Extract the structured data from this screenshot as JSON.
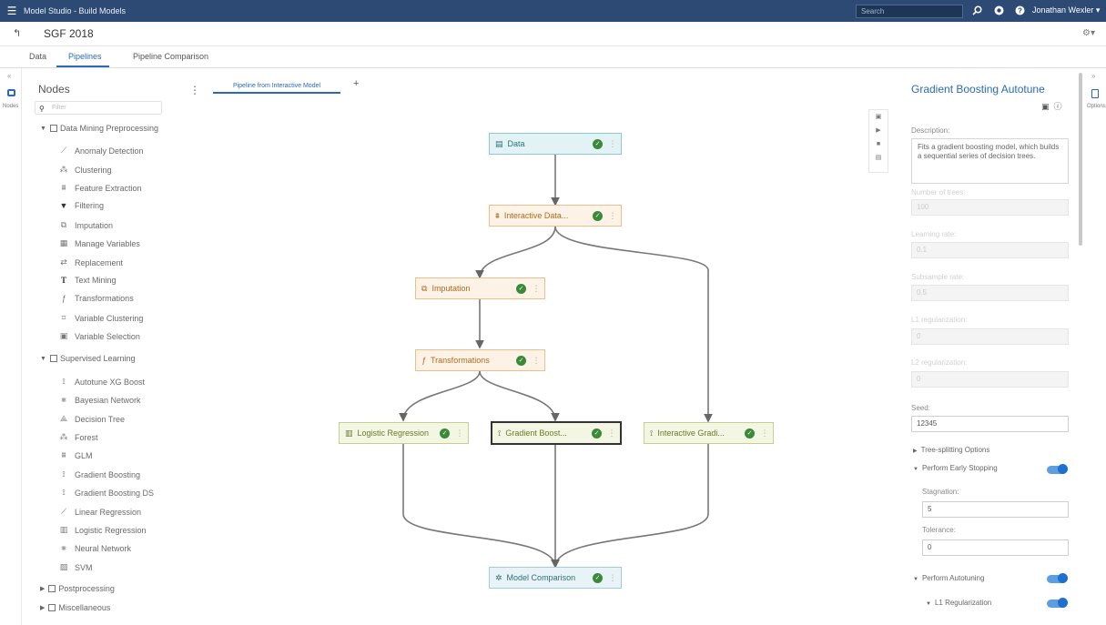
{
  "app": {
    "title": "Model Studio - Build Models",
    "search_placeholder": "Search",
    "user": "Jonathan Wexler ▾"
  },
  "project": {
    "name": "SGF 2018"
  },
  "tabs": [
    {
      "label": "Data"
    },
    {
      "label": "Pipelines"
    },
    {
      "label": "Pipeline Comparison"
    }
  ],
  "leftrail": {
    "label": "Nodes"
  },
  "nodes_panel": {
    "title": "Nodes",
    "filter_placeholder": "Filter",
    "groups": [
      {
        "label": "Data Mining Preprocessing",
        "expanded": true,
        "items": [
          {
            "label": "Anomaly Detection",
            "icon": "anomaly-icon"
          },
          {
            "label": "Clustering",
            "icon": "clustering-icon"
          },
          {
            "label": "Feature Extraction",
            "icon": "feature-extraction-icon"
          },
          {
            "label": "Filtering",
            "icon": "filter-icon"
          },
          {
            "label": "Imputation",
            "icon": "imputation-icon"
          },
          {
            "label": "Manage Variables",
            "icon": "manage-variables-icon"
          },
          {
            "label": "Replacement",
            "icon": "replacement-icon"
          },
          {
            "label": "Text Mining",
            "icon": "text-mining-icon"
          },
          {
            "label": "Transformations",
            "icon": "transformations-icon"
          },
          {
            "label": "Variable Clustering",
            "icon": "variable-clustering-icon"
          },
          {
            "label": "Variable Selection",
            "icon": "variable-selection-icon"
          }
        ]
      },
      {
        "label": "Supervised Learning",
        "expanded": true,
        "items": [
          {
            "label": "Autotune XG Boost",
            "icon": "xgboost-icon"
          },
          {
            "label": "Bayesian Network",
            "icon": "bayesian-network-icon"
          },
          {
            "label": "Decision Tree",
            "icon": "decision-tree-icon"
          },
          {
            "label": "Forest",
            "icon": "forest-icon"
          },
          {
            "label": "GLM",
            "icon": "glm-icon"
          },
          {
            "label": "Gradient Boosting",
            "icon": "gradient-boosting-icon"
          },
          {
            "label": "Gradient Boosting DS",
            "icon": "gradient-boosting-ds-icon"
          },
          {
            "label": "Linear Regression",
            "icon": "linear-regression-icon"
          },
          {
            "label": "Logistic Regression",
            "icon": "logistic-regression-icon"
          },
          {
            "label": "Neural Network",
            "icon": "neural-network-icon"
          },
          {
            "label": "SVM",
            "icon": "svm-icon"
          }
        ]
      },
      {
        "label": "Postprocessing",
        "expanded": false,
        "items": []
      },
      {
        "label": "Miscellaneous",
        "expanded": false,
        "items": []
      }
    ]
  },
  "canvas": {
    "pipeline_tab": "Pipeline from Interactive Model",
    "add_tab": "+",
    "nodes": [
      {
        "id": "data",
        "label": "Data",
        "type": "data",
        "icon": "table-icon"
      },
      {
        "id": "interactive_data",
        "label": "Interactive Data...",
        "type": "prep",
        "icon": "interactive-data-icon"
      },
      {
        "id": "imputation",
        "label": "Imputation",
        "type": "prep",
        "icon": "imputation-icon"
      },
      {
        "id": "transformations",
        "label": "Transformations",
        "type": "prep",
        "icon": "transformations-icon"
      },
      {
        "id": "logistic",
        "label": "Logistic Regression",
        "type": "sup",
        "icon": "logistic-regression-icon"
      },
      {
        "id": "gradient",
        "label": "Gradient Boost...",
        "type": "sup",
        "icon": "gradient-boosting-icon",
        "selected": true
      },
      {
        "id": "interactive_grad",
        "label": "Interactive Gradi...",
        "type": "sup",
        "icon": "gradient-boosting-icon"
      },
      {
        "id": "model_comparison",
        "label": "Model Comparison",
        "type": "post",
        "icon": "model-comparison-icon"
      }
    ]
  },
  "options": {
    "title": "Gradient Boosting Autotune",
    "description_label": "Description:",
    "description": "Fits a gradient boosting model, which builds a sequential series of decision trees.",
    "number_of_trees": {
      "label": "Number of trees:",
      "value": "100"
    },
    "learning_rate": {
      "label": "Learning rate:",
      "value": "0.1"
    },
    "subsample_rate": {
      "label": "Subsample rate:",
      "value": "0.5"
    },
    "l1_regularization": {
      "label": "L1 regularization:",
      "value": "0"
    },
    "l2_regularization": {
      "label": "L2 regularization:",
      "value": "0"
    },
    "seed": {
      "label": "Seed:",
      "value": "12345"
    },
    "tree_splitting": "Tree-splitting Options",
    "early_stopping": {
      "label": "Perform Early Stopping",
      "on": true
    },
    "stagnation": {
      "label": "Stagnation:",
      "value": "5"
    },
    "tolerance": {
      "label": "Tolerance:",
      "value": "0"
    },
    "autotuning": {
      "label": "Perform Autotuning",
      "on": true
    },
    "l1_reg_tuning": {
      "label": "L1 Regularization",
      "on": true
    }
  },
  "rightrail": {
    "label": "Options"
  },
  "colors": {
    "topbar": "#2c4a73",
    "accent": "#2c6ab8",
    "data_node": "#e3f3f5",
    "prep_node": "#fdf2e6",
    "sup_node": "#f3f6e3"
  }
}
